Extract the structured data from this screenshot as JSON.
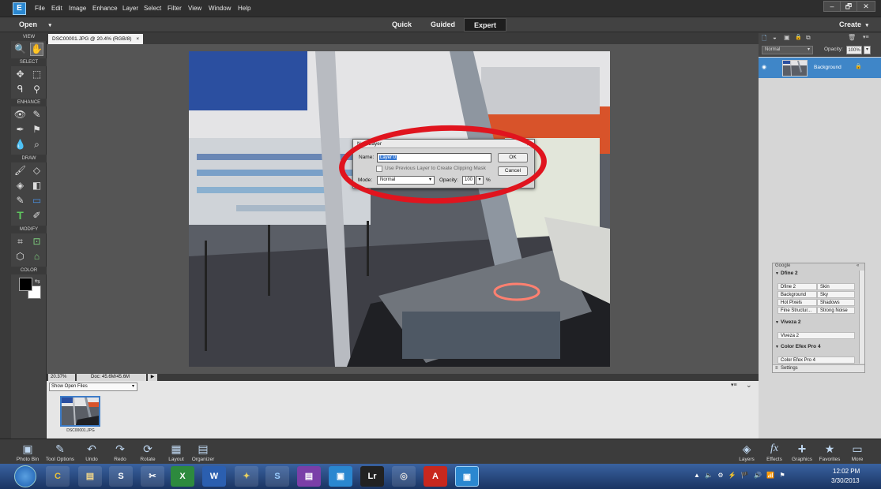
{
  "menubar": {
    "logo": "E",
    "items": [
      "File",
      "Edit",
      "Image",
      "Enhance",
      "Layer",
      "Select",
      "Filter",
      "View",
      "Window",
      "Help"
    ],
    "win_controls": [
      "–",
      "🗗",
      "✕"
    ]
  },
  "modebar": {
    "open_label": "Open",
    "open_caret": "▾",
    "tabs": [
      "Quick",
      "Guided",
      "Expert"
    ],
    "active_tab": "Expert",
    "create_label": "Create",
    "create_caret": "▾"
  },
  "toolbox": {
    "sections": [
      "VIEW",
      "SELECT",
      "ENHANCE",
      "DRAW",
      "MODIFY",
      "COLOR"
    ],
    "icons": {
      "view": [
        "🔍",
        "✋"
      ],
      "select": [
        "✥",
        "⬚",
        "ᑫ",
        "⚲"
      ],
      "enhance": [
        "👁",
        "✎",
        "✒",
        "⚑",
        "💧",
        "⌕"
      ],
      "draw": [
        "🖌",
        "◇",
        "◈",
        "◧",
        "✎",
        "▭",
        "T",
        "✐"
      ],
      "modify": [
        "⌗",
        "⊡",
        "⬡",
        "⌂"
      ]
    }
  },
  "document": {
    "tab_title": "DSC00001.JPG @ 20.4% (RGB/8)",
    "tab_close": "×"
  },
  "statusbar": {
    "zoom": "20.37%",
    "doc_size": "Doc: 45.6M/45.6M",
    "arrow": "▶"
  },
  "photobin": {
    "dropdown": "Show Open Files",
    "dropdown_caret": "▾",
    "thumb_label": "DSC00001.JPG",
    "controls": [
      "▾≡",
      "⌄"
    ]
  },
  "layers_panel": {
    "icons": [
      "🗋",
      "◒",
      "▣",
      "🔒",
      "⧉",
      "🗑",
      "▾≡"
    ],
    "blend_mode": "Normal",
    "blend_caret": "▾",
    "opacity_label": "Opacity:",
    "opacity_value": "100%",
    "layer_name": "Background",
    "eye_icon": "◉",
    "lock_icon": "🔒"
  },
  "google_panel": {
    "title": "Google",
    "header_controls": "«",
    "groups": [
      {
        "name": "Dfine 2",
        "cells": [
          "Dfine 2",
          "Skin",
          "Background",
          "Sky",
          "Hot Pixels",
          "Shadows",
          "Fine Structur...",
          "Strong Noise"
        ]
      },
      {
        "name": "Viveza 2",
        "cells": [
          "Viveza 2"
        ]
      },
      {
        "name": "Color Efex Pro 4",
        "cells": [
          "Color Efex Pro 4"
        ]
      }
    ],
    "settings_label": "Settings",
    "triangle": "▼"
  },
  "taskbar_left": [
    {
      "label": "Photo Bin",
      "icon": "▣"
    },
    {
      "label": "Tool Options",
      "icon": "✎"
    },
    {
      "label": "Undo",
      "icon": "↶"
    },
    {
      "label": "Redo",
      "icon": "↷"
    },
    {
      "label": "Rotate",
      "icon": "⟳"
    },
    {
      "label": "Layout",
      "icon": "▦"
    },
    {
      "label": "Organizer",
      "icon": "▤"
    }
  ],
  "taskbar_right": [
    {
      "label": "Layers",
      "icon": "◈"
    },
    {
      "label": "Effects",
      "icon": "fx"
    },
    {
      "label": "Graphics",
      "icon": "+"
    },
    {
      "label": "Favorites",
      "icon": "★"
    },
    {
      "label": "More",
      "icon": "▭"
    }
  ],
  "dialog": {
    "title": "New Layer",
    "close": "✕",
    "name_label": "Name:",
    "name_value": "Layer 0",
    "checkbox_label": "Use Previous Layer to Create Clipping Mask",
    "mode_label": "Mode:",
    "mode_value": "Normal",
    "mode_caret": "▾",
    "opacity_label": "Opacity:",
    "opacity_value": "100",
    "opacity_caret": "▾",
    "percent": "%",
    "ok_label": "OK",
    "cancel_label": "Cancel"
  },
  "windows_taskbar": {
    "apps": [
      "C",
      "▤",
      "S",
      "✂",
      "X",
      "W",
      "✦",
      "S",
      "▤",
      "▣",
      "Lr",
      "◎",
      "A",
      "▣"
    ],
    "tray": "▲ 🔈 ⚙ ⚡ 🏴 🔊 📶 ⚑",
    "time": "12:02 PM",
    "date": "3/30/2013"
  },
  "colors": {
    "accent_blue": "#3f86c8",
    "annotation_red": "#e0141e",
    "dialog_bg": "#d4d4d4"
  }
}
